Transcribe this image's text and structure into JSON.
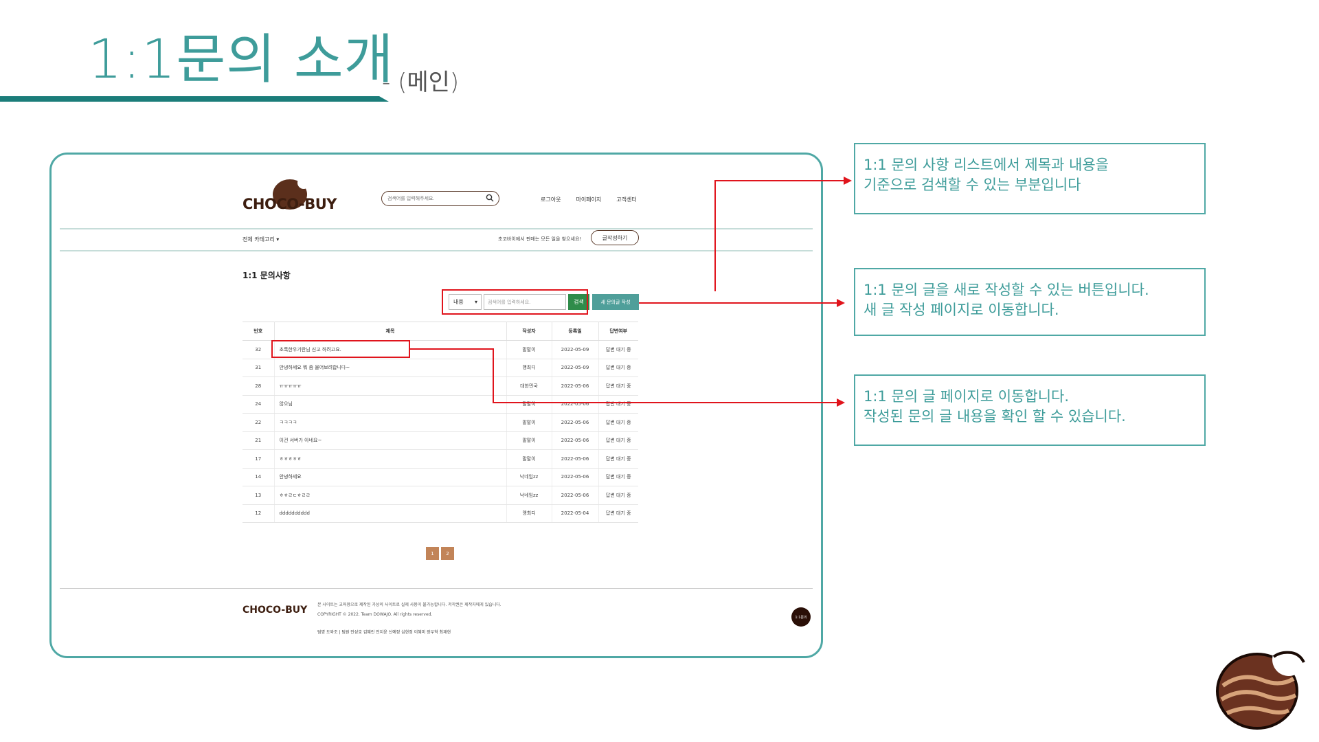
{
  "slide": {
    "title": "1:1문의 소개",
    "subtitle": "- (메인)"
  },
  "site": {
    "logo": "CHOCO-BUY",
    "search_placeholder": "검색어를 입력해주세요.",
    "nav": [
      "로그아웃",
      "마이페이지",
      "고객센터"
    ],
    "category_label": "전체 카테고리 ▾",
    "promo_text": "초코바이에서 판매는 모든 일을 찾으세요!",
    "write_review_label": "글작성하기",
    "page_heading": "1:1 문의사항"
  },
  "search_bar": {
    "select_value": "내용",
    "input_placeholder": "검색어를 입력하세요.",
    "search_label": "검색",
    "new_inquiry_label": "새 문의글 작성"
  },
  "table": {
    "headers": [
      "번호",
      "제목",
      "작성자",
      "등록일",
      "답변여부"
    ],
    "rows": [
      {
        "no": "32",
        "title": "초록한우기란님 신고 하려고요.",
        "author": "말말이",
        "date": "2022-05-09",
        "status": "답변 대기 중"
      },
      {
        "no": "31",
        "title": "안녕하세요 뭐 좀 물어보려합니다~",
        "author": "맹최디",
        "date": "2022-05-09",
        "status": "답변 대기 중"
      },
      {
        "no": "28",
        "title": "ㅠㅠㅠㅠㅠ",
        "author": "대한민국",
        "date": "2022-05-06",
        "status": "답변 대기 중"
      },
      {
        "no": "24",
        "title": "않으님",
        "author": "말말이",
        "date": "2022-05-06",
        "status": "답변 대기 중"
      },
      {
        "no": "22",
        "title": "ㅋㅋㅋㅋ",
        "author": "말말이",
        "date": "2022-05-06",
        "status": "답변 대기 중"
      },
      {
        "no": "21",
        "title": "이건 서버가 아네요~",
        "author": "말말이",
        "date": "2022-05-06",
        "status": "답변 대기 중"
      },
      {
        "no": "17",
        "title": "ㅎㅎㅎㅎㅎ",
        "author": "말말이",
        "date": "2022-05-06",
        "status": "답변 대기 중"
      },
      {
        "no": "14",
        "title": "안녕하세요",
        "author": "낙네임zz",
        "date": "2022-05-06",
        "status": "답변 대기 중"
      },
      {
        "no": "13",
        "title": "ㅎㅎㄹㄷㅎㄹㄹ",
        "author": "낙네임zz",
        "date": "2022-05-06",
        "status": "답변 대기 중"
      },
      {
        "no": "12",
        "title": "dddddddddd",
        "author": "맹최디",
        "date": "2022-05-04",
        "status": "답변 대기 중"
      }
    ]
  },
  "pagination": [
    "1",
    "2"
  ],
  "footer": {
    "logo": "CHOCO-BUY",
    "notice": "본 사이트는 교육용으로 제작된 가상의 사이트로 실제 사용이 불가능합니다. 저작권은 제작자에게 있습니다.",
    "copyright": "COPYRIGHT © 2022. Team DOWAJO. All rights reserved.",
    "team": "팀명 도와조 | 팀원 인성호 김혜린 인지윤 신예정 심현정 이혜미 장우혁 최재현",
    "badge": "1:1문의"
  },
  "callouts": {
    "c1": [
      "1:1 문의 사항 리스트에서 제목과 내용을",
      "기준으로 검색할 수 있는 부분입니다"
    ],
    "c2": [
      "1:1 문의 글을 새로 작성할 수 있는 버튼입니다.",
      "새 글 작성 페이지로 이동합니다."
    ],
    "c3": [
      "1:1 문의 글 페이지로 이동합니다.",
      "작성된 문의 글 내용을 확인 할 수 있습니다."
    ]
  },
  "colors": {
    "accent": "#3e9c9a",
    "highlight": "#e0141c",
    "brand_brown": "#5b2f1c"
  }
}
